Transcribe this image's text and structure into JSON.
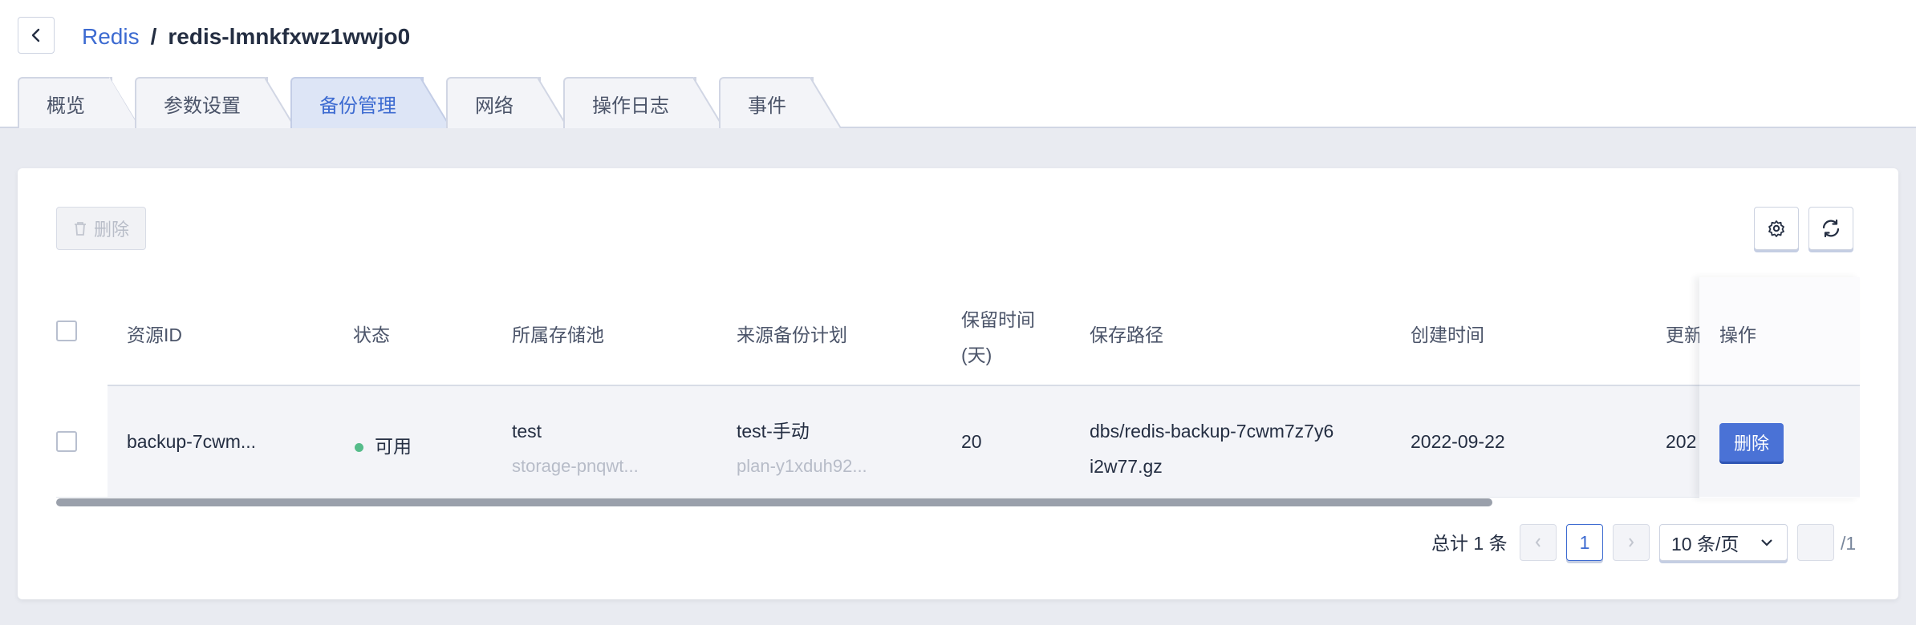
{
  "breadcrumb": {
    "parent": "Redis",
    "separator": "/",
    "current": "redis-lmnkfxwz1wwjo0"
  },
  "tabs": [
    {
      "label": "概览",
      "active": false
    },
    {
      "label": "参数设置",
      "active": false
    },
    {
      "label": "备份管理",
      "active": true
    },
    {
      "label": "网络",
      "active": false
    },
    {
      "label": "操作日志",
      "active": false
    },
    {
      "label": "事件",
      "active": false
    }
  ],
  "toolbar": {
    "delete_label": "删除",
    "delete_icon": "trash-icon",
    "settings_icon": "gear-icon",
    "refresh_icon": "refresh-icon"
  },
  "table": {
    "headers": {
      "resource_id": "资源ID",
      "status": "状态",
      "storage_pool": "所属存储池",
      "source_plan": "来源备份计划",
      "retention_line1": "保留时间",
      "retention_line2": "(天)",
      "path": "保存路径",
      "created": "创建时间",
      "updated": "更新",
      "actions": "操作"
    },
    "rows": [
      {
        "resource_id": "backup-7cwm...",
        "status": "可用",
        "storage_pool": "test",
        "storage_pool_id": "storage-pnqwt...",
        "source_plan": "test-手动",
        "source_plan_id": "plan-y1xduh92...",
        "retention": "20",
        "path_line1": "dbs/redis-backup-7cwm7z7y6",
        "path_line2": "i2w77.gz",
        "created": "2022-09-22",
        "updated": "202",
        "action_label": "删除"
      }
    ]
  },
  "pagination": {
    "total": "总计 1 条",
    "current_page": "1",
    "page_size": "10 条/页",
    "page_input": "",
    "total_pages": "/1"
  },
  "colors": {
    "accent": "#3d6bd1",
    "primary_button": "#4a72d6",
    "status_ok": "#55bc8a"
  }
}
